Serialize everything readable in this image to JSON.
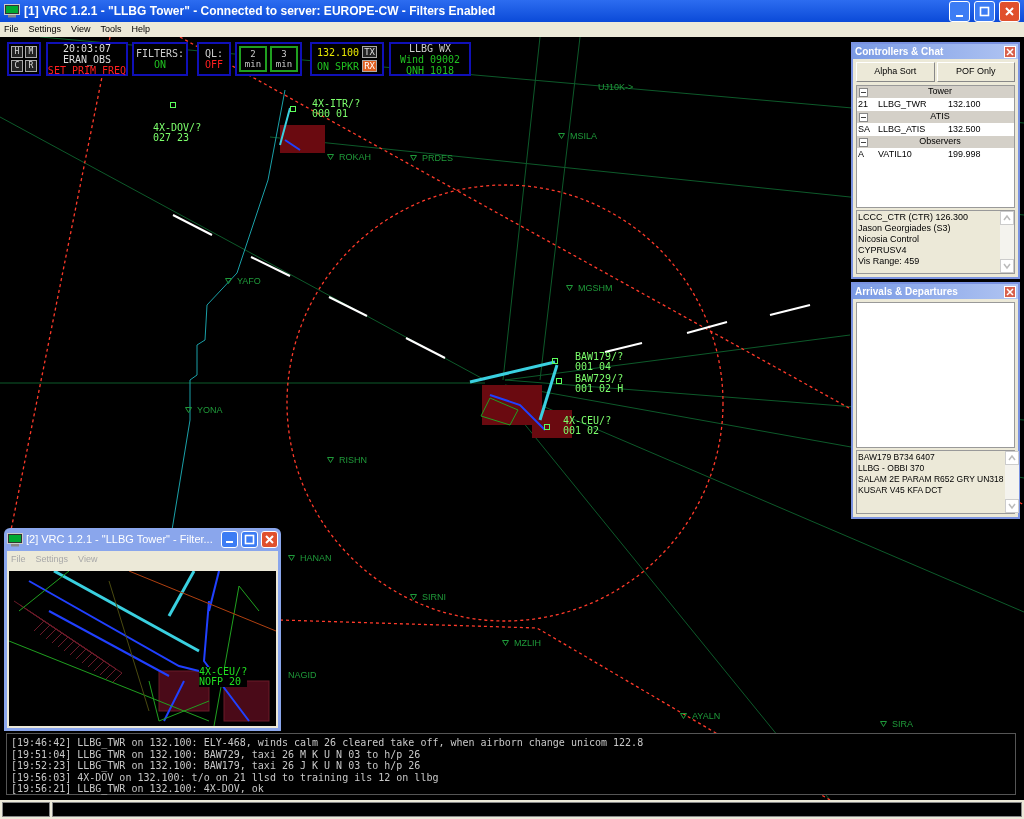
{
  "window": {
    "title": "[1] VRC 1.2.1 - \"LLBG Tower\" - Connected to server: EUROPE-CW - Filters Enabled"
  },
  "menu": [
    "File",
    "Settings",
    "View",
    "Tools",
    "Help"
  ],
  "toolbar": {
    "view_buttons": [
      "H",
      "M",
      "C",
      "R"
    ],
    "clock": {
      "time": "20:03:07",
      "callsign": "ERAN_OBS",
      "alert": "SET PRIM FREQ"
    },
    "filters": {
      "label": "FILTERS:",
      "value": "ON",
      "on": true
    },
    "quick_look": {
      "label": "QL:",
      "value": "OFF",
      "on": false
    },
    "timers": [
      {
        "value": "2",
        "unit": "min"
      },
      {
        "value": "3",
        "unit": "min"
      }
    ],
    "comms": {
      "frequency": "132.100",
      "speaker": "ON SPKR",
      "tx": {
        "label": "TX",
        "active": false
      },
      "rx": {
        "label": "RX",
        "active": true
      }
    },
    "weather": {
      "station": "LLBG WX",
      "wind": "Wind 09002",
      "qnh": "QNH 1018"
    }
  },
  "fixes": [
    {
      "name": "UJ10K->",
      "kind": "label"
    },
    {
      "name": "MSILA",
      "kind": "fix"
    },
    {
      "name": "ROKAH",
      "kind": "fix"
    },
    {
      "name": "PRDES",
      "kind": "fix"
    },
    {
      "name": "YAFO",
      "kind": "fix"
    },
    {
      "name": "MGSHM",
      "kind": "fix"
    },
    {
      "name": "YONA",
      "kind": "fix"
    },
    {
      "name": "RISHN",
      "kind": "fix"
    },
    {
      "name": "HANAN",
      "kind": "fix"
    },
    {
      "name": "SIRNI",
      "kind": "fix"
    },
    {
      "name": "NAGID",
      "kind": "label"
    },
    {
      "name": "MZLIH",
      "kind": "fix"
    },
    {
      "name": "AYALN",
      "kind": "fix"
    },
    {
      "name": "SIRA",
      "kind": "fix"
    }
  ],
  "aircraft": [
    {
      "callsign": "4X-ITR/?",
      "data": "000 01"
    },
    {
      "callsign": "4X-DOV/?",
      "data": "027 23"
    },
    {
      "callsign": "BAW179/?",
      "data": "001 04"
    },
    {
      "callsign": "BAW729/?",
      "data": "001 02 H"
    },
    {
      "callsign": "4X-CEU/?",
      "data": "001 02"
    }
  ],
  "controllers_panel": {
    "title": "Controllers & Chat",
    "buttons": [
      "Alpha Sort",
      "POF Only"
    ],
    "groups": [
      {
        "name": "Tower",
        "expanded": true,
        "rows": [
          {
            "rating": "21",
            "callsign": "LLBG_TWR",
            "frequency": "132.100"
          }
        ]
      },
      {
        "name": "ATIS",
        "expanded": true,
        "rows": [
          {
            "rating": "SA",
            "callsign": "LLBG_ATIS",
            "frequency": "132.500"
          }
        ]
      },
      {
        "name": "Observers",
        "expanded": true,
        "rows": [
          {
            "rating": "A",
            "callsign": "VATIL10",
            "frequency": "199.998"
          }
        ]
      }
    ],
    "details": [
      "LCCC_CTR (CTR) 126.300",
      "Jason Georgiades (S3)",
      "Nicosia Control",
      "CYPRUSV4",
      "Vis Range: 459"
    ]
  },
  "flights_panel": {
    "title": "Arrivals & Departures",
    "details": [
      "BAW179  B734  6407",
      "LLBG - OBBI  370",
      "SALAM 2E PARAM R652 GRY UN318",
      "KUSAR V45 KFA  DCT"
    ]
  },
  "second_window": {
    "title": "[2] VRC 1.2.1 - \"LLBG Tower\" - Filter...",
    "menu": [
      "File",
      "Settings",
      "View"
    ],
    "aircraft": {
      "callsign": "4X-CEU/?",
      "data": "NOFP 20"
    }
  },
  "chat_log": [
    "[19:46:42] LLBG_TWR on 132.100: ELY-468, winds calm 26 cleared take off, when airborn change unicom 122.8",
    "[19:51:04] LLBG_TWR on 132.100: BAW729, taxi 26 M K U N 03 to h/p 26",
    "[19:52:23] LLBG_TWR on 132.100: BAW179, taxi 26 J K U N 03 to h/p 26",
    "[19:56:03] 4X-DOV on 132.100: t/o on 21 llsd to training ils 12 on llbg",
    "[19:56:21] LLBG_TWR on 132.100: 4X-DOV, ok"
  ]
}
